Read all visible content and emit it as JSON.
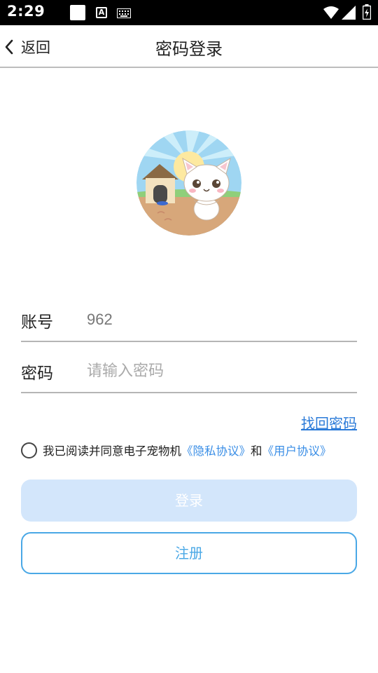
{
  "status_bar": {
    "time": "2:29",
    "icons": [
      "notification-square-icon",
      "a-icon",
      "keyboard-icon",
      "wifi-icon",
      "signal-icon",
      "battery-icon"
    ]
  },
  "nav": {
    "back_label": "返回",
    "title": "密码登录"
  },
  "form": {
    "account_label": "账号",
    "account_value": "962",
    "password_label": "密码",
    "password_placeholder": "请输入密码",
    "forgot_link": "找回密码"
  },
  "agreement": {
    "text": "我已阅读并同意电子宠物机",
    "privacy_link": "《隐私协议》",
    "and_text": "和",
    "user_link": "《用户协议》"
  },
  "buttons": {
    "login": "登录",
    "register": "注册"
  },
  "colors": {
    "accent": "#2a7ad8",
    "login_bg": "#d3e6fb",
    "register_border": "#4aa8e6"
  }
}
